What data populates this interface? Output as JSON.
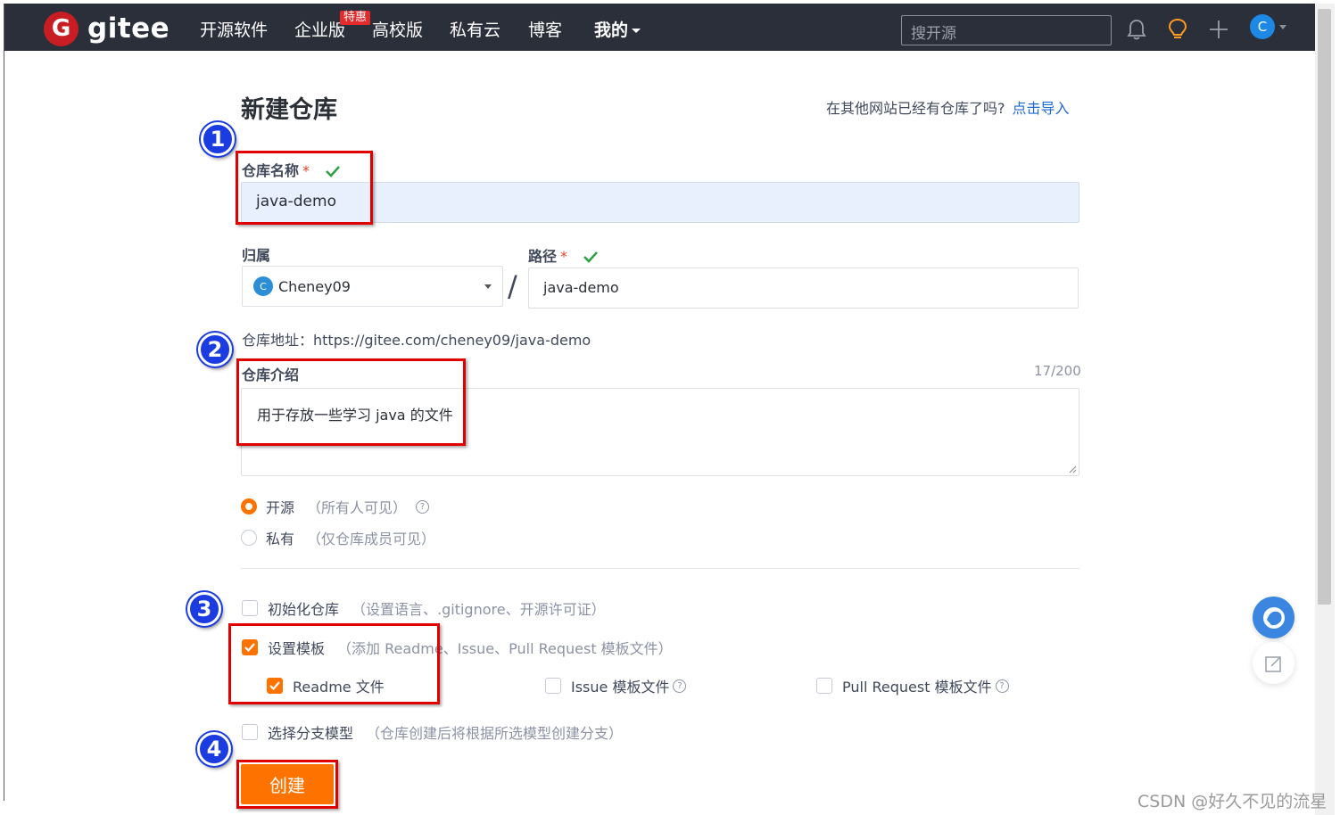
{
  "header": {
    "logo_mark": "G",
    "logo_text": "gitee",
    "nav": [
      "开源软件",
      "企业版",
      "高校版",
      "私有云",
      "博客",
      "我的"
    ],
    "enterprise_badge": "特惠",
    "search_placeholder": "搜开源",
    "avatar_letter": "C",
    "icons": [
      "bell-icon",
      "lightbulb-icon",
      "plus-icon"
    ]
  },
  "page": {
    "title": "新建仓库",
    "import_hint": "在其他网站已经有仓库了吗?",
    "import_link": "点击导入"
  },
  "form": {
    "name_label": "仓库名称",
    "name_value": "java-demo",
    "owner_label": "归属",
    "owner_avatar": "C",
    "owner_value": "Cheney09",
    "slash": "/",
    "path_label": "路径",
    "path_value": "java-demo",
    "required_mark": "*",
    "repo_url": "仓库地址：https://gitee.com/cheney09/java-demo",
    "desc_label": "仓库介绍",
    "desc_count": "17/200",
    "desc_value": "用于存放一些学习 java 的文件",
    "visibility": [
      {
        "label": "开源",
        "hint": "（所有人可见）",
        "selected": true,
        "help": true
      },
      {
        "label": "私有",
        "hint": "（仅仓库成员可见）",
        "selected": false,
        "help": false
      }
    ],
    "init_repo": {
      "label": "初始化仓库",
      "hint": "（设置语言、.gitignore、开源许可证）",
      "checked": false
    },
    "template": {
      "label": "设置模板",
      "hint": "（添加 Readme、Issue、Pull Request 模板文件）",
      "checked": true
    },
    "template_options": [
      {
        "label": "Readme 文件",
        "checked": true,
        "help": false
      },
      {
        "label": "Issue 模板文件",
        "checked": false,
        "help": true
      },
      {
        "label": "Pull Request 模板文件",
        "checked": false,
        "help": true
      }
    ],
    "branch_model": {
      "label": "选择分支模型",
      "hint": "（仓库创建后将根据所选模型创建分支）",
      "checked": false
    },
    "submit_label": "创建"
  },
  "annotations": {
    "steps": [
      "1",
      "2",
      "3",
      "4"
    ],
    "color": "#e00000",
    "badge_color": "#1a3ce0"
  },
  "colors": {
    "accent": "#fe7300",
    "link": "#1e6bd0",
    "topbar": "#2b2f3a",
    "brand": "#c71d23"
  },
  "help_glyph": "?",
  "watermark": "CSDN @好久不见的流星"
}
